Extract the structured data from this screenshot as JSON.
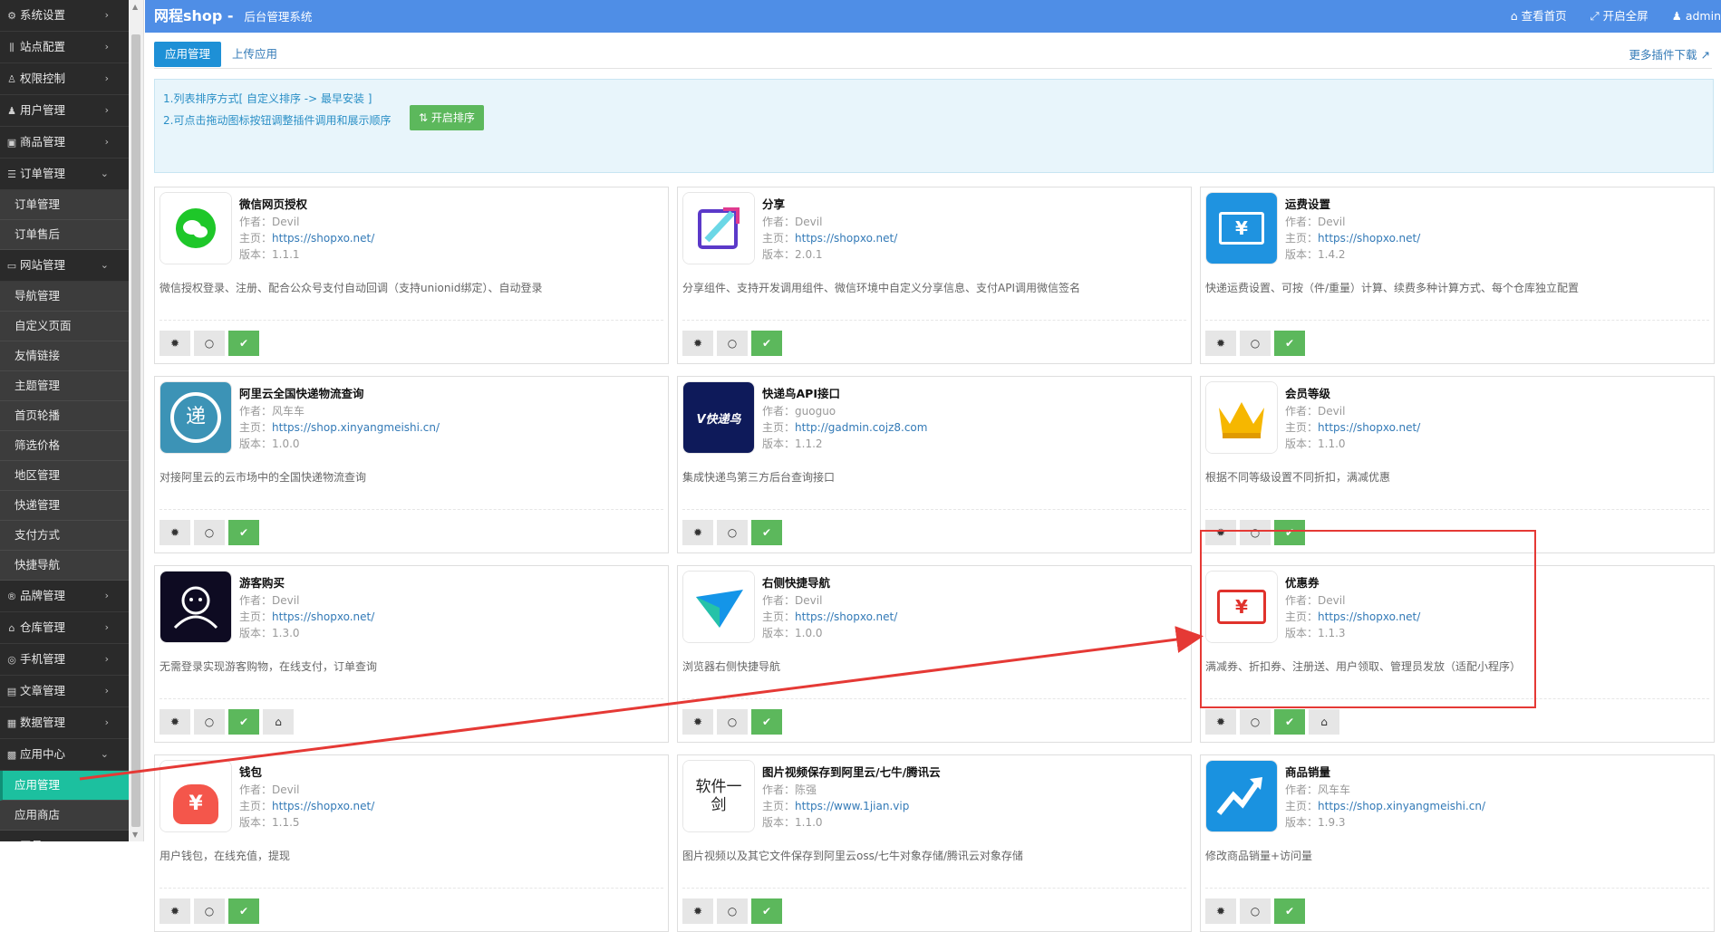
{
  "sidebar": {
    "groups": [
      {
        "icon": "⚙",
        "label": "系统设置",
        "chevron": "›"
      },
      {
        "icon": "⫼",
        "label": "站点配置",
        "chevron": "›"
      },
      {
        "icon": "♙",
        "label": "权限控制",
        "chevron": "›"
      },
      {
        "icon": "♟",
        "label": "用户管理",
        "chevron": "›"
      },
      {
        "icon": "▣",
        "label": "商品管理",
        "chevron": "›"
      },
      {
        "icon": "☰",
        "label": "订单管理",
        "chevron": "⌄"
      }
    ],
    "order_sub": [
      "订单管理",
      "订单售后"
    ],
    "website_group": {
      "icon": "▭",
      "label": "网站管理",
      "chevron": "⌄"
    },
    "website_sub": [
      "导航管理",
      "自定义页面",
      "友情链接",
      "主题管理",
      "首页轮播",
      "筛选价格",
      "地区管理",
      "快递管理",
      "支付方式",
      "快捷导航"
    ],
    "groups2": [
      {
        "icon": "®",
        "label": "品牌管理",
        "chevron": "›"
      },
      {
        "icon": "⌂",
        "label": "仓库管理",
        "chevron": "›"
      },
      {
        "icon": "◎",
        "label": "手机管理",
        "chevron": "›"
      },
      {
        "icon": "▤",
        "label": "文章管理",
        "chevron": "›"
      },
      {
        "icon": "▦",
        "label": "数据管理",
        "chevron": "›"
      },
      {
        "icon": "▩",
        "label": "应用中心",
        "chevron": "⌄"
      }
    ],
    "app_sub": [
      {
        "label": "应用管理",
        "active": true
      },
      {
        "label": "应用商店",
        "active": false
      }
    ],
    "tools_group": {
      "icon": "✕",
      "label": "工具",
      "chevron": "›"
    }
  },
  "header": {
    "brand": "网程shop -",
    "subtitle": "后台管理系统",
    "links": [
      {
        "icon": "⌂",
        "label": "查看首页"
      },
      {
        "icon": "⤢",
        "label": "开启全屏"
      },
      {
        "icon": "♟",
        "label": "admin"
      }
    ]
  },
  "tabs": [
    {
      "label": "应用管理",
      "active": true
    },
    {
      "label": "上传应用",
      "active": false
    }
  ],
  "more_link": "更多插件下载",
  "more_link_icon": "↗",
  "info": {
    "line1": "1.列表排序方式[ 自定义排序 -> 最早安装 ]",
    "line2": "2.可点击拖动图标按钮调整插件调用和展示顺序",
    "sort_button": "⇅ 开启排序"
  },
  "labels": {
    "author": "作者：",
    "homepage": "主页：",
    "version": "版本："
  },
  "button_icons": {
    "settings": "✹",
    "toggle": "○",
    "enabled": "✔",
    "home": "⌂"
  },
  "plugins": [
    {
      "name": "微信网页授权",
      "author": "Devil",
      "url": "https://shopxo.net/",
      "version": "1.1.1",
      "desc": "微信授权登录、注册、配合公众号支付自动回调（支持unionid绑定）、自动登录",
      "logo": "wechat-logo",
      "home": false
    },
    {
      "name": "分享",
      "author": "Devil",
      "url": "https://shopxo.net/",
      "version": "2.0.1",
      "desc": "分享组件、支持开发调用组件、微信环境中自定义分享信息、支付API调用微信签名",
      "logo": "share-logo",
      "home": false
    },
    {
      "name": "运费设置",
      "author": "Devil",
      "url": "https://shopxo.net/",
      "version": "1.4.2",
      "desc": "快递运费设置、可按（件/重量）计算、续费多种计算方式、每个仓库独立配置",
      "logo": "freight-logo",
      "logo_text": "¥",
      "home": false
    },
    {
      "name": "阿里云全国快递物流查询",
      "author": "风车车",
      "url": "https://shop.xinyangmeishi.cn/",
      "version": "1.0.0",
      "desc": "对接阿里云的云市场中的全国快递物流查询",
      "logo": "express-logo",
      "logo_text": "递",
      "home": false
    },
    {
      "name": "快递鸟API接口",
      "author": "guoguo",
      "url": "http://gadmin.cojz8.com",
      "version": "1.1.2",
      "desc": "集成快递鸟第三方后台查询接口",
      "logo": "kdniao-logo",
      "logo_text": "V快递鸟",
      "home": false
    },
    {
      "name": "会员等级",
      "author": "Devil",
      "url": "https://shopxo.net/",
      "version": "1.1.0",
      "desc": "根据不同等级设置不同折扣，满减优惠",
      "logo": "crown-logo",
      "home": false
    },
    {
      "name": "游客购买",
      "author": "Devil",
      "url": "https://shopxo.net/",
      "version": "1.3.0",
      "desc": "无需登录实现游客购物，在线支付，订单查询",
      "logo": "guest-logo",
      "home": true
    },
    {
      "name": "右侧快捷导航",
      "author": "Devil",
      "url": "https://shopxo.net/",
      "version": "1.0.0",
      "desc": "浏览器右侧快捷导航",
      "logo": "nav-logo",
      "home": false
    },
    {
      "name": "优惠券",
      "author": "Devil",
      "url": "https://shopxo.net/",
      "version": "1.1.3",
      "desc": "满减券、折扣券、注册送、用户领取、管理员发放（适配小程序）",
      "logo": "coupon-logo",
      "logo_text": "¥",
      "home": true
    },
    {
      "name": "钱包",
      "author": "Devil",
      "url": "https://shopxo.net/",
      "version": "1.1.5",
      "desc": "用户钱包，在线充值，提现",
      "logo": "wallet-logo",
      "logo_text": "¥",
      "home": false
    },
    {
      "name": "图片视频保存到阿里云/七牛/腾讯云",
      "author": "陈强",
      "url": "https://www.1jian.vip",
      "version": "1.1.0",
      "desc": "图片视频以及其它文件保存到阿里云oss/七牛对象存储/腾讯云对象存储",
      "logo": "storage-logo",
      "logo_text": "软件一剑",
      "home": false
    },
    {
      "name": "商品销量",
      "author": "风车车",
      "url": "https://shop.xinyangmeishi.cn/",
      "version": "1.9.3",
      "desc": "修改商品销量+访问量",
      "logo": "sales-logo",
      "home": false
    }
  ],
  "colors": {
    "sidebar": "#2a2a2a",
    "accent": "#4f8ee6",
    "active": "#1cc09f",
    "success": "#5cb85c",
    "highlight": "#e53935"
  }
}
